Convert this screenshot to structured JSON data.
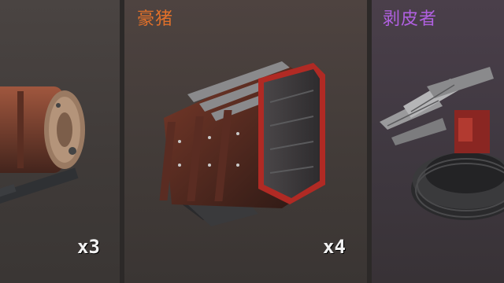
{
  "cards": [
    {
      "id": "left",
      "name": "",
      "count": "x3",
      "icon": "cylinder-engine-part-icon"
    },
    {
      "id": "mid",
      "name": "豪猪",
      "name_color": "#e0702a",
      "count": "x4",
      "icon": "armored-cabin-part-icon"
    },
    {
      "id": "right",
      "name": "剥皮者",
      "name_color": "#b060e0",
      "count": "",
      "icon": "spiked-turret-part-icon"
    }
  ]
}
